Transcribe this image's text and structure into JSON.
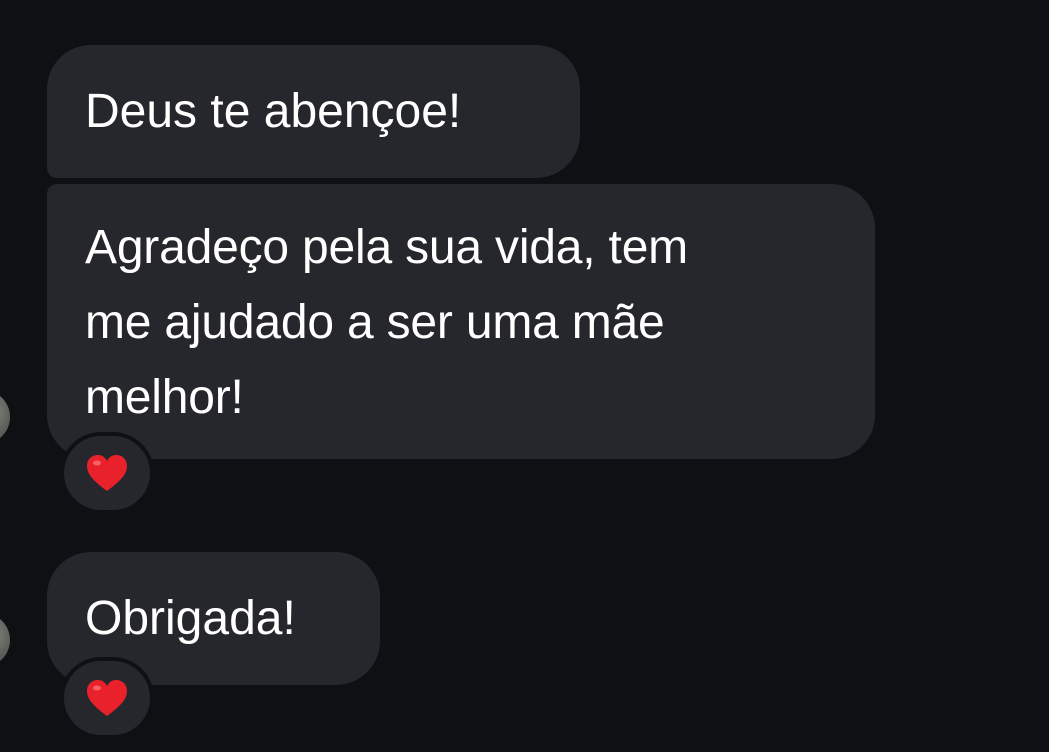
{
  "messages": [
    {
      "text": "Deus te abençoe!"
    },
    {
      "text": "Agradeço pela sua vida, tem\nme ajudado a ser uma mãe\nmelhor!",
      "reaction": "heart-emoji"
    },
    {
      "text": "Obrigada!",
      "reaction": "heart-emoji"
    }
  ],
  "colors": {
    "background": "#0e1014",
    "bubble": "#25272c",
    "text": "#ffffff",
    "heart": "#e8212b"
  }
}
